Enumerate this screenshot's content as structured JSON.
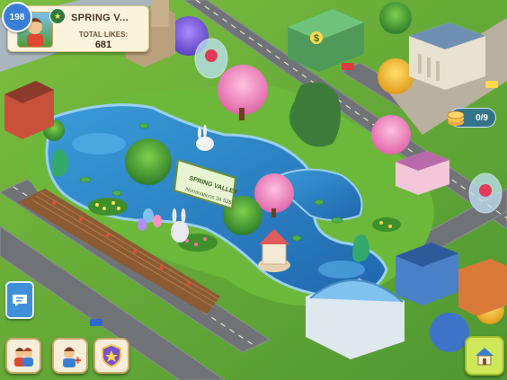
{
  "hud": {
    "level": "198",
    "town_name": "SPRING V...",
    "likes_label": "TOTAL LIKES:",
    "likes_value": "681",
    "counter": "0/9"
  },
  "sign": {
    "title": "SPRING VALLEY",
    "subtitle": "Nominations 34 535"
  },
  "icons": {
    "chat": "chat-bubble-icon",
    "friends": "friends-icon",
    "add_friend": "add-friend-icon",
    "badge": "shield-badge-icon",
    "home": "house-icon",
    "coin": "coin-stack-icon"
  },
  "colors": {
    "grass": "#5fa33a",
    "water": "#2a7ec4",
    "road": "#6f7378",
    "accent_blue": "#3f90d8",
    "card": "#fbf3dc"
  }
}
